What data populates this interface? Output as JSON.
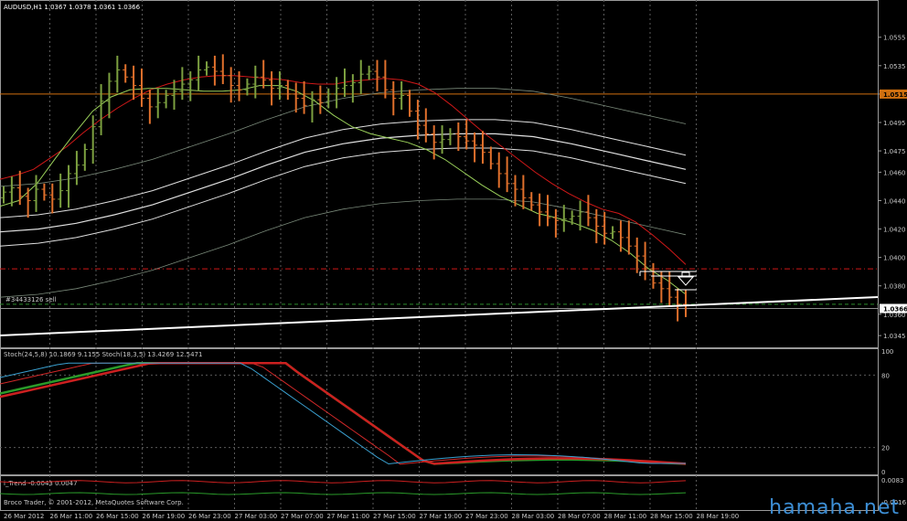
{
  "header": {
    "symbol_line": "AUDUSD,H1  1.0367 1.0378 1.0361 1.0366"
  },
  "stoch_header": "Stoch(24,5,8) 10.1869 9.1155  Stoch(18,3,5) 13.4269 12.5471",
  "trend_header": "i_Trend -0.0043 0.0047",
  "copyright": "Broco Trader, © 2001-2012, MetaQuotes Software Corp.",
  "order_label": "#34433126 sell",
  "watermark": "hamaha.net",
  "colors": {
    "background": "#000000",
    "grid": "#5a5a5a",
    "bull": "#7ca040",
    "bear": "#e0702c",
    "ma_red": "#d01818",
    "ma_green": "#9ad05a",
    "bands": "#e0e0e0",
    "price_line": "#d07010",
    "stop_line": "#d01818",
    "order_line": "#2a8a2a",
    "trend_red": "#cc2020",
    "trend_green": "#2a9a2a"
  },
  "chart_data": [
    {
      "type": "candlestick",
      "title": "AUDUSD,H1",
      "ohlc_shown": {
        "open": 1.0367,
        "high": 1.0378,
        "low": 1.0361,
        "close": 1.0366
      },
      "y_ticks": [
        "1.0555",
        "1.0535",
        "1.0515",
        "1.0495",
        "1.0475",
        "1.0460",
        "1.0440",
        "1.0420",
        "1.0400",
        "1.0380",
        "1.0360",
        "1.0345"
      ],
      "ylim": [
        1.0338,
        1.0578
      ],
      "price_tag": "1.0515",
      "current_tag": "1.0366",
      "current_price": 1.0366,
      "level_price_line": 1.0515,
      "level_stop_line": 1.0392,
      "level_order_line": 1.0367,
      "closes": [
        1.0446,
        1.0449,
        1.0443,
        1.044,
        1.0448,
        1.0444,
        1.0441,
        1.0447,
        1.0459,
        1.0465,
        1.0476,
        1.0492,
        1.051,
        1.0524,
        1.0532,
        1.0527,
        1.0521,
        1.0512,
        1.0506,
        1.0509,
        1.0514,
        1.0517,
        1.0522,
        1.0525,
        1.0532,
        1.0534,
        1.0531,
        1.0528,
        1.0521,
        1.0518,
        1.0522,
        1.0527,
        1.0525,
        1.0519,
        1.0521,
        1.0515,
        1.0512,
        1.0507,
        1.0511,
        1.0509,
        1.0515,
        1.0519,
        1.0521,
        1.0523,
        1.0529,
        1.0531,
        1.0527,
        1.0518,
        1.0512,
        1.0514,
        1.0503,
        1.0493,
        1.0487,
        1.0481,
        1.0483,
        1.0487,
        1.0485,
        1.0482,
        1.0479,
        1.0474,
        1.0466,
        1.0459,
        1.0452,
        1.0448,
        1.0442,
        1.0437,
        1.0432,
        1.0428,
        1.0426,
        1.0427,
        1.0429,
        1.0432,
        1.0428,
        1.0422,
        1.0417,
        1.0418,
        1.0414,
        1.0408,
        1.0401,
        1.0392,
        1.0382,
        1.0378,
        1.0372,
        1.0367,
        1.0366
      ],
      "ma_red": [
        1.0455,
        1.0458,
        1.0462,
        1.047,
        1.0478,
        1.0488,
        1.0497,
        1.0505,
        1.0512,
        1.0518,
        1.0522,
        1.0525,
        1.0527,
        1.0528,
        1.0528,
        1.0527,
        1.0526,
        1.0525,
        1.0523,
        1.0522,
        1.0522,
        1.0524,
        1.0525,
        1.0526,
        1.0525,
        1.0522,
        1.0516,
        1.0507,
        1.0497,
        1.0487,
        1.0478,
        1.0469,
        1.046,
        1.0452,
        1.0445,
        1.0439,
        1.0434,
        1.0431,
        1.0425,
        1.0416,
        1.0406,
        1.0395
      ],
      "ma_green": [
        1.0436,
        1.044,
        1.0452,
        1.047,
        1.0487,
        1.0503,
        1.0513,
        1.0518,
        1.0519,
        1.0519,
        1.0518,
        1.0517,
        1.0517,
        1.0518,
        1.0521,
        1.0521,
        1.0517,
        1.051,
        1.05,
        1.0492,
        1.0487,
        1.0484,
        1.0481,
        1.0476,
        1.0469,
        1.046,
        1.0451,
        1.0443,
        1.0437,
        1.0431,
        1.0428,
        1.0424,
        1.0419,
        1.0412,
        1.0403,
        1.0392,
        1.0384,
        1.0374
      ],
      "band_mid": [
        1.0418,
        1.042,
        1.0424,
        1.043,
        1.0437,
        1.0446,
        1.0455,
        1.0465,
        1.0474,
        1.048,
        1.0484,
        1.0486,
        1.0487,
        1.0487,
        1.0485,
        1.048,
        1.0474,
        1.0468,
        1.0462
      ]
    },
    {
      "type": "line",
      "title": "Stoch(24,5,8) / Stoch(18,3,5)",
      "values_shown": [
        10.1869,
        9.1155,
        13.4269,
        12.5471
      ],
      "y_ticks": [
        "100",
        "80",
        "20",
        "0"
      ],
      "ylim": [
        0,
        100
      ]
    },
    {
      "type": "line",
      "title": "i_Trend",
      "values_shown": [
        -0.0043,
        0.0047
      ],
      "y_ticks": [
        "0.0083",
        "-0.0016"
      ]
    }
  ],
  "x_axis_labels": [
    "26 Mar 2012",
    "26 Mar 11:00",
    "26 Mar 15:00",
    "26 Mar 19:00",
    "26 Mar 23:00",
    "27 Mar 03:00",
    "27 Mar 07:00",
    "27 Mar 11:00",
    "27 Mar 15:00",
    "27 Mar 19:00",
    "27 Mar 23:00",
    "28 Mar 03:00",
    "28 Mar 07:00",
    "28 Mar 11:00",
    "28 Mar 15:00",
    "28 Mar 19:00"
  ]
}
